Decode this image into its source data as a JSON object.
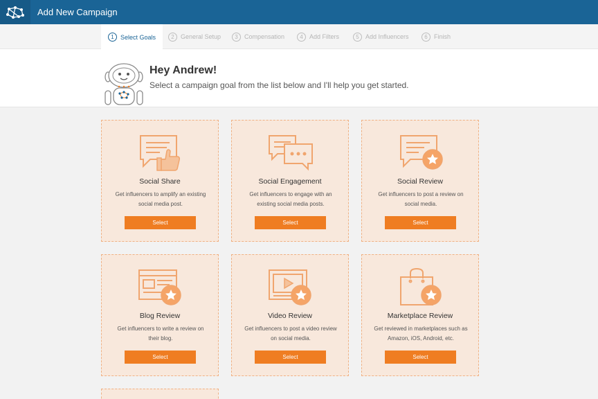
{
  "header": {
    "title": "Add New Campaign",
    "logo_icon": "network-logo-icon"
  },
  "steps": [
    {
      "num": "1",
      "label": "Select Goals",
      "active": true
    },
    {
      "num": "2",
      "label": "General Setup",
      "active": false
    },
    {
      "num": "3",
      "label": "Compensation",
      "active": false
    },
    {
      "num": "4",
      "label": "Add Filters",
      "active": false
    },
    {
      "num": "5",
      "label": "Add Influencers",
      "active": false
    },
    {
      "num": "6",
      "label": "Finish",
      "active": false
    }
  ],
  "greeting": {
    "title": "Hey Andrew!",
    "subtitle": "Select a campaign goal from the list below and I'll help you get started.",
    "avatar_icon": "robot-assistant-icon"
  },
  "goals": [
    {
      "title": "Social Share",
      "desc_line1": "Get influencers to amplify an existing",
      "desc_line2": "social media post.",
      "button": "Select",
      "icon": "thumbs-up-post-icon"
    },
    {
      "title": "Social Engagement",
      "desc_line1": "Get influencers to engage with an",
      "desc_line2": "existing social media posts.",
      "button": "Select",
      "icon": "chat-bubbles-icon"
    },
    {
      "title": "Social Review",
      "desc_line1": "Get influencers to post a review on",
      "desc_line2": "social media.",
      "button": "Select",
      "icon": "star-review-bubble-icon"
    },
    {
      "title": "Blog Review",
      "desc_line1": "Get influencers to write a review on",
      "desc_line2": "their blog.",
      "button": "Select",
      "icon": "blog-star-icon"
    },
    {
      "title": "Video Review",
      "desc_line1": "Get influencers to post a video review",
      "desc_line2": "on social media.",
      "button": "Select",
      "icon": "video-star-icon"
    },
    {
      "title": "Marketplace Review",
      "desc_line1": "Get reviewed in marketplaces such as",
      "desc_line2": "Amazon, iOS, Android, etc.",
      "button": "Select",
      "icon": "shopping-bag-star-icon"
    }
  ],
  "colors": {
    "header": "#1a6496",
    "accent": "#ef7d22",
    "card_bg": "#f8e8dc",
    "icon": "#f0a56e"
  }
}
